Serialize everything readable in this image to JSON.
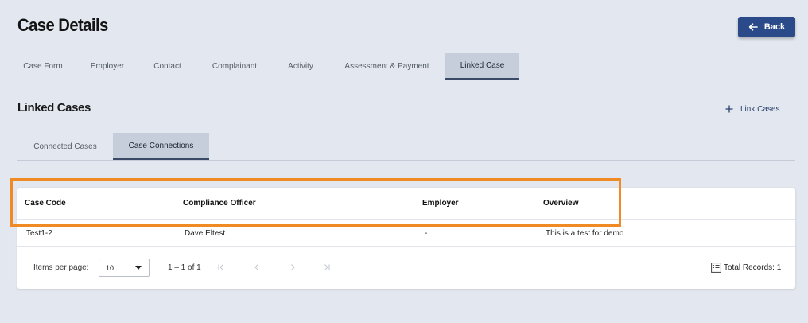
{
  "header": {
    "title": "Case Details",
    "back_label": "Back"
  },
  "tabs": [
    {
      "label": "Case Form"
    },
    {
      "label": "Employer"
    },
    {
      "label": "Contact"
    },
    {
      "label": "Complainant"
    },
    {
      "label": "Activity"
    },
    {
      "label": "Assessment & Payment"
    },
    {
      "label": "Linked Case",
      "active": true
    }
  ],
  "section": {
    "title": "Linked Cases",
    "link_cases_label": "Link Cases"
  },
  "subtabs": [
    {
      "label": "Connected Cases"
    },
    {
      "label": "Case Connections",
      "active": true
    }
  ],
  "table": {
    "columns": [
      "Case Code",
      "Compliance Officer",
      "Employer",
      "Overview"
    ],
    "rows": [
      [
        "Test1-2",
        "Dave Eltest",
        "-",
        "This is a test for demo"
      ]
    ]
  },
  "paginator": {
    "items_per_page_label": "Items per page:",
    "items_per_page_value": "10",
    "range_label": "1 – 1 of 1",
    "total_records_label": "Total Records: 1"
  },
  "colors": {
    "accent": "#2a4a8a",
    "highlight": "#f08a24",
    "active_tab_bg": "#c6cedc"
  }
}
